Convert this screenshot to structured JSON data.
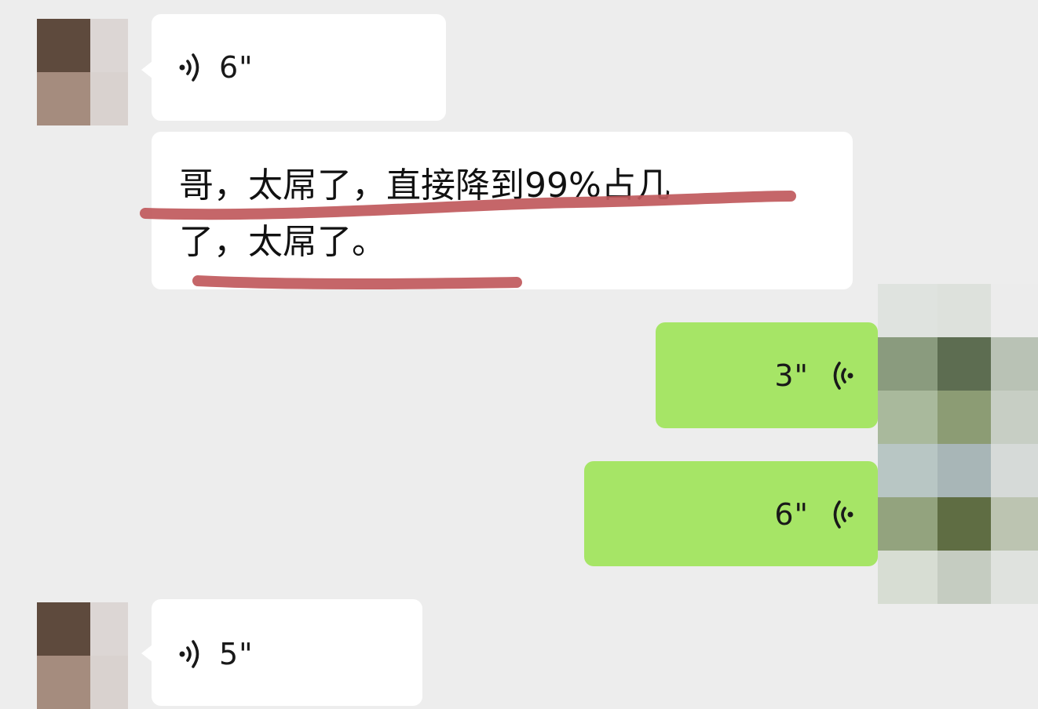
{
  "messages": [
    {
      "id": "m1",
      "direction": "incoming",
      "type": "voice",
      "duration": "6\""
    },
    {
      "id": "m2",
      "direction": "incoming",
      "type": "text",
      "line1": "哥，太屌了，直接降到99%占几",
      "line2": "了，太屌了。"
    },
    {
      "id": "m3",
      "direction": "outgoing",
      "type": "voice",
      "duration": "3\""
    },
    {
      "id": "m4",
      "direction": "outgoing",
      "type": "voice",
      "duration": "6\""
    },
    {
      "id": "m5",
      "direction": "incoming",
      "type": "voice",
      "duration": "5\""
    }
  ],
  "icons": {
    "incoming_voice": "voice-wave-icon",
    "outgoing_voice": "voice-wave-icon",
    "avatar": "avatar"
  },
  "colors": {
    "background": "#ededed",
    "incoming_bubble": "#ffffff",
    "outgoing_bubble": "#a6e566",
    "underline_marker": "#c0595c"
  }
}
